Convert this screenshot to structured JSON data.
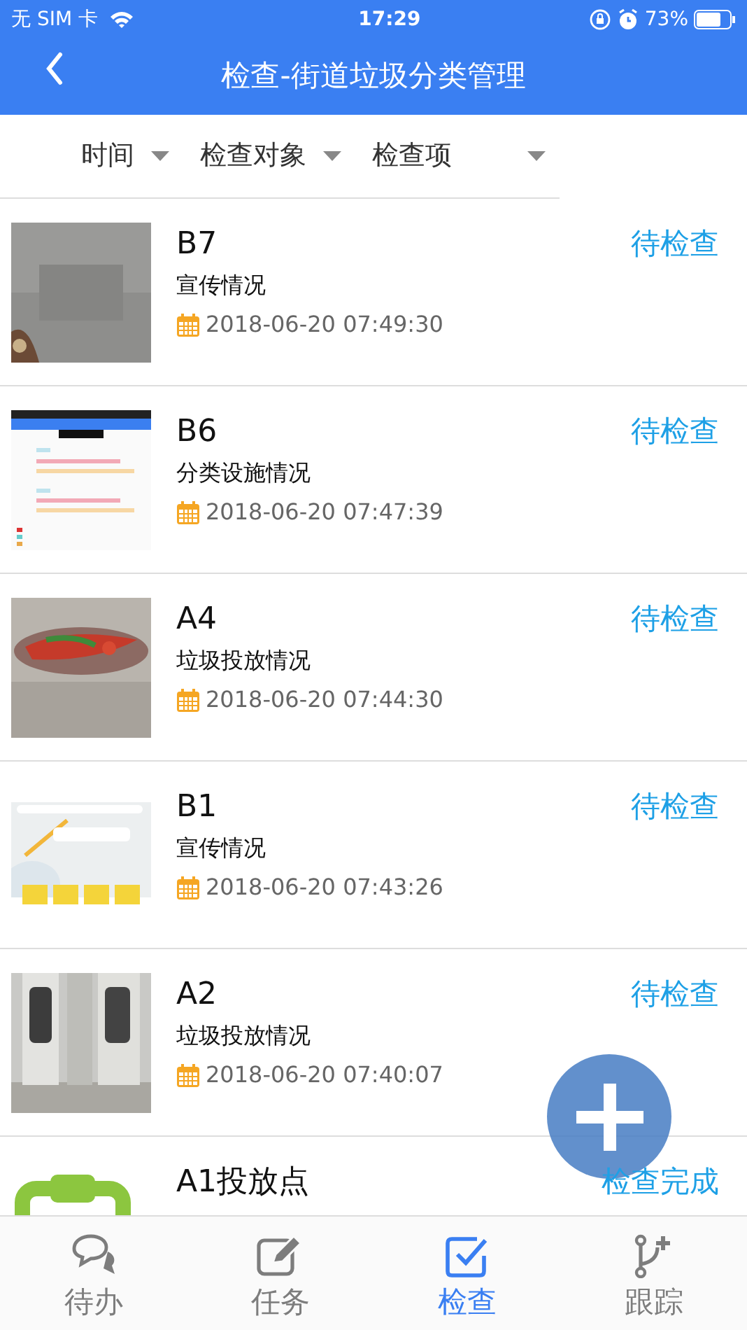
{
  "status_bar": {
    "carrier": "无 SIM 卡",
    "time": "17:29",
    "battery": "73%"
  },
  "header": {
    "title": "检查-街道垃圾分类管理"
  },
  "filters": [
    {
      "label": "时间"
    },
    {
      "label": "检查对象"
    },
    {
      "label": "检查项"
    }
  ],
  "records": [
    {
      "kind": "picture",
      "title": "B7",
      "item": "宣传情况",
      "date": "2018-06-20 07:49:30",
      "status": "待检查"
    },
    {
      "kind": "picture",
      "title": "B6",
      "item": "分类设施情况",
      "date": "2018-06-20 07:47:39",
      "status": "待检查"
    },
    {
      "kind": "picture",
      "title": "A4",
      "item": "垃圾投放情况",
      "date": "2018-06-20 07:44:30",
      "status": "待检查"
    },
    {
      "kind": "picture",
      "title": "B1",
      "item": "宣传情况",
      "date": "2018-06-20 07:43:26",
      "status": "待检查"
    },
    {
      "kind": "picture",
      "title": "A2",
      "item": "垃圾投放情况",
      "date": "2018-06-20 07:40:07",
      "status": "待检查"
    },
    {
      "kind": "icon",
      "title": "A1投放点",
      "status": "检查完成"
    }
  ],
  "tabs": [
    {
      "label": "待办",
      "selected": false
    },
    {
      "label": "任务",
      "selected": false
    },
    {
      "label": "检查",
      "selected": true
    },
    {
      "label": "跟踪",
      "selected": false
    }
  ]
}
